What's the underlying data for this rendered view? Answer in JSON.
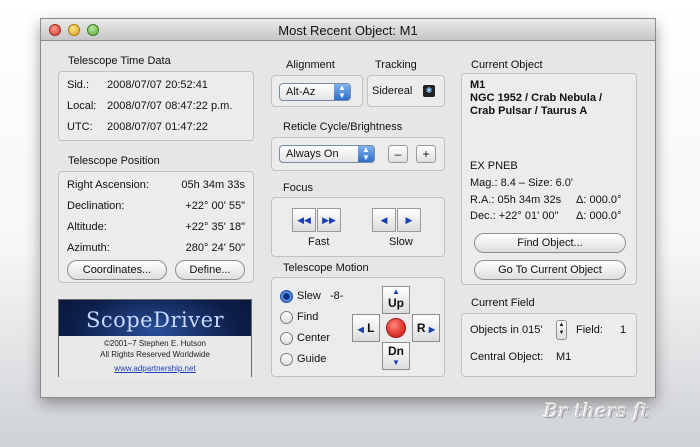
{
  "window": {
    "title": "Most Recent Object: M1"
  },
  "time": {
    "title": "Telescope Time Data",
    "rows": [
      {
        "label": "Sid.:",
        "value": "2008/07/07  20:52:41"
      },
      {
        "label": "Local:",
        "value": "2008/07/07  08:47:22 p.m."
      },
      {
        "label": "UTC:",
        "value": "2008/07/07  01:47:22"
      }
    ]
  },
  "position": {
    "title": "Telescope Position",
    "rows": [
      {
        "label": "Right Ascension:",
        "value": "05h 34m 33s"
      },
      {
        "label": "Declination:",
        "value": "+22° 00' 55\""
      },
      {
        "label": "Altitude:",
        "value": "+22° 35' 18\""
      },
      {
        "label": "Azimuth:",
        "value": "280° 24' 50\""
      }
    ],
    "coordinates_button": "Coordinates...",
    "define_button": "Define..."
  },
  "logo": {
    "name": "ScopeDriver",
    "copyright": "©2001–7 Stephen E. Hutson",
    "rights": "All Rights Reserved Worldwide",
    "link": "www.adpartnership.net"
  },
  "alignment": {
    "title": "Alignment",
    "value": "Alt-Az"
  },
  "tracking": {
    "title": "Tracking",
    "value": "Sidereal"
  },
  "reticle": {
    "title": "Reticle Cycle/Brightness",
    "value": "Always On",
    "minus": "–",
    "plus": "+"
  },
  "focus": {
    "title": "Focus",
    "fast": "Fast",
    "slow": "Slow"
  },
  "motion": {
    "title": "Telescope Motion",
    "rates": [
      "Slew",
      "Find",
      "Center",
      "Guide"
    ],
    "selected_rate": "Slew",
    "rate_value": "-8-",
    "up": "Up",
    "down": "Dn",
    "left": "L",
    "right": "R"
  },
  "current_object": {
    "title": "Current Object",
    "id": "M1",
    "names_line1": "NGC 1952 / Crab Nebula /",
    "names_line2": "Crab Pulsar / Taurus A",
    "type": "EX PNEB",
    "mag_size": "Mag.: 8.4 – Size: 6.0'",
    "ra": "R.A.:  05h 34m 32s",
    "ra_delta": "Δ: 000.0°",
    "dec": "Dec.: +22° 01' 00\"",
    "dec_delta": "Δ: 000.0°",
    "find_button": "Find Object...",
    "goto_button": "Go To Current Object"
  },
  "current_field": {
    "title": "Current Field",
    "objects_label": "Objects in 015'",
    "field_label": "Field:",
    "field_value": "1",
    "central_label": "Central Object:",
    "central_value": "M1"
  },
  "watermark": "Br thers ft",
  "colors": {
    "accent": "#2d6ec8",
    "stop": "#e23a33",
    "arrow": "#1a3fb5",
    "logo_bg": "#0d1f4a"
  }
}
